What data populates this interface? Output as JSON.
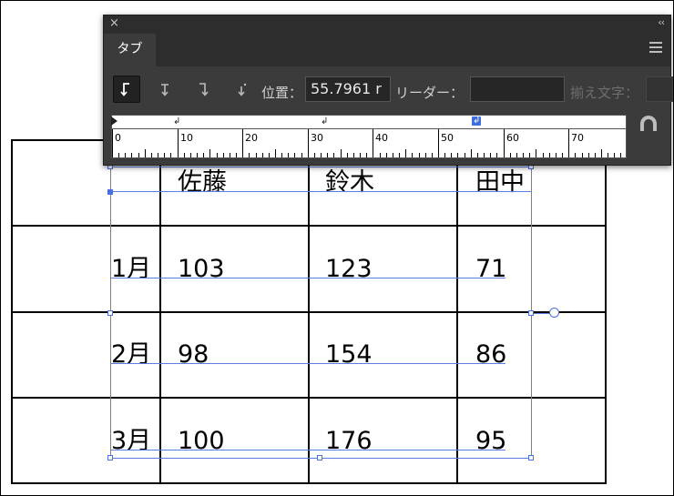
{
  "table": {
    "headers": [
      "佐藤",
      "鈴木",
      "田中"
    ],
    "rows": [
      {
        "month": "1月",
        "values": [
          "103",
          "123",
          "71"
        ]
      },
      {
        "month": "2月",
        "values": [
          "98",
          "154",
          "86"
        ]
      },
      {
        "month": "3月",
        "values": [
          "100",
          "176",
          "95"
        ]
      }
    ]
  },
  "panel": {
    "tab_label": "タブ",
    "close_glyph": "×",
    "collapse_glyph": "‹‹",
    "position_label": "位置：",
    "position_value": "55.7961 r",
    "leader_label": "リーダー：",
    "leader_value": "",
    "align_on_label": "揃え文字：",
    "align_on_value": "",
    "ruler_numbers": [
      "0",
      "10",
      "20",
      "30",
      "40",
      "50",
      "60",
      "70"
    ],
    "tab_glyphs": {
      "left": "↲",
      "selected": "↲"
    },
    "icons": [
      "left-justified-tab-icon",
      "center-justified-tab-icon",
      "right-justified-tab-icon",
      "decimal-justified-tab-icon",
      "snap-above-frame-icon",
      "panel-menu-icon"
    ]
  }
}
